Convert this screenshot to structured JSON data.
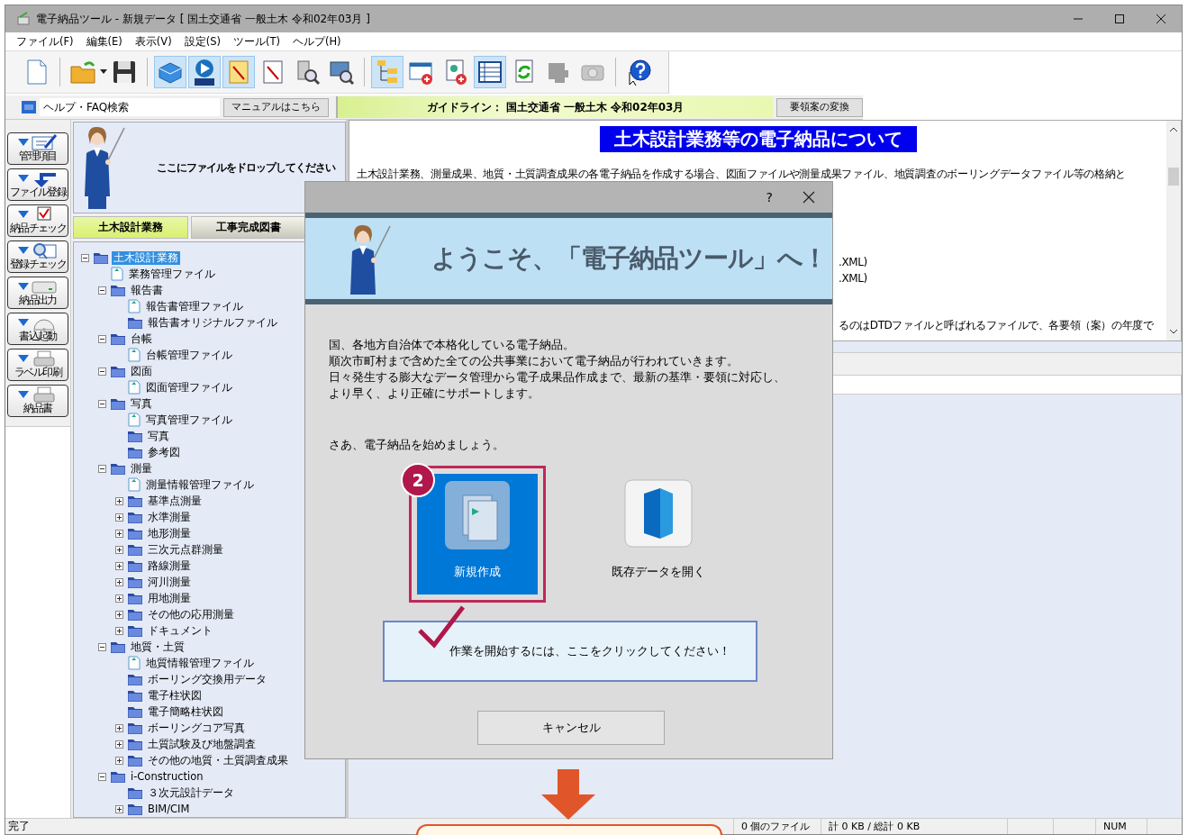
{
  "window": {
    "title": "電子納品ツール - 新規データ [ 国土交通省 一般土木 令和02年03月 ]"
  },
  "menu": [
    "ファイル(F)",
    "編集(E)",
    "表示(V)",
    "設定(S)",
    "ツール(T)",
    "ヘルプ(H)"
  ],
  "toolbar": [
    {
      "kind": "button",
      "pressed": false,
      "disabled": false
    },
    {
      "kind": "separator"
    },
    {
      "kind": "button",
      "pressed": false,
      "disabled": false
    },
    {
      "kind": "dropdown"
    },
    {
      "kind": "button",
      "pressed": false,
      "disabled": false
    },
    {
      "kind": "separator"
    },
    {
      "kind": "button",
      "pressed": true,
      "disabled": false
    },
    {
      "kind": "button",
      "pressed": true,
      "disabled": false
    },
    {
      "kind": "button",
      "pressed": true,
      "disabled": false
    },
    {
      "kind": "button",
      "pressed": false,
      "disabled": false
    },
    {
      "kind": "button",
      "pressed": false,
      "disabled": false
    },
    {
      "kind": "button",
      "pressed": false,
      "disabled": false
    },
    {
      "kind": "separator"
    },
    {
      "kind": "button",
      "pressed": true,
      "disabled": false
    },
    {
      "kind": "button",
      "pressed": false,
      "disabled": false
    },
    {
      "kind": "button",
      "pressed": false,
      "disabled": false
    },
    {
      "kind": "button",
      "pressed": true,
      "disabled": false
    },
    {
      "kind": "button",
      "pressed": false,
      "disabled": false
    },
    {
      "kind": "button",
      "pressed": false,
      "disabled": true
    },
    {
      "kind": "button",
      "pressed": false,
      "disabled": true
    },
    {
      "kind": "separator"
    },
    {
      "kind": "button",
      "pressed": false,
      "disabled": false
    }
  ],
  "help_search": {
    "placeholder": "ヘルプ・FAQ検索"
  },
  "manual_button": "マニュアルはこちら",
  "guideline": "ガイドライン： 国土交通省 一般土木 令和02年03月",
  "convert_button": "要領案の変換",
  "side_buttons": [
    "管理項目",
    "ファイル登録",
    "納品チェック",
    "登録チェック",
    "納品出力",
    "書込起動",
    "ラベル印刷",
    "納品書"
  ],
  "drop_zone": {
    "text": "ここにファイルをドロップしてください"
  },
  "tabs": [
    {
      "label": "土木設計業務",
      "selected": true
    },
    {
      "label": "工事完成図書",
      "selected": false
    }
  ],
  "tree": [
    {
      "label": "土木設計業務",
      "kind": "folder",
      "expanded": true,
      "selected": true,
      "children": [
        {
          "label": "業務管理ファイル",
          "kind": "file",
          "selected": false
        },
        {
          "label": "報告書",
          "kind": "folder",
          "expanded": true,
          "selected": false,
          "children": [
            {
              "label": "報告書管理ファイル",
              "kind": "file",
              "selected": false
            },
            {
              "label": "報告書オリジナルファイル",
              "kind": "folder",
              "selected": false
            }
          ]
        },
        {
          "label": "台帳",
          "kind": "folder",
          "expanded": true,
          "selected": false,
          "children": [
            {
              "label": "台帳管理ファイル",
              "kind": "file",
              "selected": false
            }
          ]
        },
        {
          "label": "図面",
          "kind": "folder",
          "expanded": true,
          "selected": false,
          "children": [
            {
              "label": "図面管理ファイル",
              "kind": "file",
              "selected": false
            }
          ]
        },
        {
          "label": "写真",
          "kind": "folder",
          "expanded": true,
          "selected": false,
          "children": [
            {
              "label": "写真管理ファイル",
              "kind": "file",
              "selected": false
            },
            {
              "label": "写真",
              "kind": "folder",
              "selected": false
            },
            {
              "label": "参考図",
              "kind": "folder",
              "selected": false
            }
          ]
        },
        {
          "label": "測量",
          "kind": "folder",
          "expanded": true,
          "selected": false,
          "children": [
            {
              "label": "測量情報管理ファイル",
              "kind": "file",
              "selected": false
            },
            {
              "label": "基準点測量",
              "kind": "folder",
              "expanded": false,
              "selected": false
            },
            {
              "label": "水準測量",
              "kind": "folder",
              "expanded": false,
              "selected": false
            },
            {
              "label": "地形測量",
              "kind": "folder",
              "expanded": false,
              "selected": false
            },
            {
              "label": "三次元点群測量",
              "kind": "folder",
              "expanded": false,
              "selected": false
            },
            {
              "label": "路線測量",
              "kind": "folder",
              "expanded": false,
              "selected": false
            },
            {
              "label": "河川測量",
              "kind": "folder",
              "expanded": false,
              "selected": false
            },
            {
              "label": "用地測量",
              "kind": "folder",
              "expanded": false,
              "selected": false
            },
            {
              "label": "その他の応用測量",
              "kind": "folder",
              "expanded": false,
              "selected": false
            },
            {
              "label": "ドキュメント",
              "kind": "folder",
              "expanded": false,
              "selected": false
            }
          ]
        },
        {
          "label": "地質・土質",
          "kind": "folder",
          "expanded": true,
          "selected": false,
          "children": [
            {
              "label": "地質情報管理ファイル",
              "kind": "file",
              "selected": false
            },
            {
              "label": "ボーリング交換用データ",
              "kind": "folder",
              "selected": false
            },
            {
              "label": "電子柱状図",
              "kind": "folder",
              "selected": false
            },
            {
              "label": "電子簡略柱状図",
              "kind": "folder",
              "selected": false
            },
            {
              "label": "ボーリングコア写真",
              "kind": "folder",
              "expanded": false,
              "selected": false
            },
            {
              "label": "土質試験及び地盤調査",
              "kind": "folder",
              "expanded": false,
              "selected": false
            },
            {
              "label": "その他の地質・土質調査成果",
              "kind": "folder",
              "expanded": false,
              "selected": false
            }
          ]
        },
        {
          "label": "i-Construction",
          "kind": "folder",
          "expanded": true,
          "selected": false,
          "children": [
            {
              "label": "３次元設計データ",
              "kind": "folder",
              "selected": false
            },
            {
              "label": "BIM/CIM",
              "kind": "folder",
              "expanded": false,
              "selected": false
            }
          ]
        }
      ]
    }
  ],
  "document": {
    "heading": "土木設計業務等の電子納品について",
    "intro": "土木設計業務、測量成果、地質・土質調査成果の各電子納品を作成する場合、図面ファイルや測量成果ファイル、地質調査のボーリングデータファイル等の格納と",
    "fragments": [
      ".XML)",
      ".XML)",
      "るのはDTDファイルと呼ばれるファイルで、各要領（案）の年度で"
    ]
  },
  "dialog": {
    "help": "?",
    "banner": "ようこそ、「電子納品ツール」へ！",
    "message": [
      "国、各地方自治体で本格化している電子納品。",
      "順次市町村まで含めた全ての公共事業において電子納品が行われていきます。",
      "日々発生する膨大なデータ管理から電子成果品作成まで、最新の基準・要領に対応し、",
      "より早く、より正確にサポートします。"
    ],
    "prompt": "さあ、電子納品を始めましょう。",
    "actions": [
      {
        "label": "新規作成",
        "selected": true
      },
      {
        "label": "既存データを開く",
        "selected": false
      }
    ],
    "step_badge": "2",
    "start_button": "作業を開始するには、ここをクリックしてください！",
    "cancel_button": "キャンセル"
  },
  "status_bar": {
    "message": "完了",
    "file_count": "0 個のファイル",
    "size": "計 0 KB / 総計 0 KB",
    "num": "NUM"
  }
}
